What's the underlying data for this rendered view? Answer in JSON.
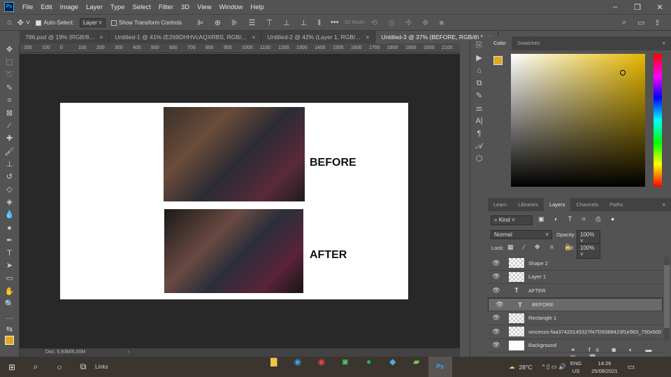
{
  "menu": [
    "File",
    "Edit",
    "Image",
    "Layer",
    "Type",
    "Select",
    "Filter",
    "3D",
    "View",
    "Window",
    "Help"
  ],
  "options": {
    "auto_select": "Auto-Select:",
    "layer_select": "Layer",
    "show_transform": "Show Transform Controls",
    "three_d_mode": "3D Mode:"
  },
  "tabs": [
    {
      "label": "786.psd @ 19% (RGB/8..."
    },
    {
      "label": "Untitled-1 @ 41% (E269DHHVcAQXRBS, RGB/..."
    },
    {
      "label": "Untitled-2 @ 42% (Layer 1, RGB/..."
    },
    {
      "label": "Untitled-3 @ 37% (BEFORE, RGB/8) *"
    }
  ],
  "ruler": [
    "200",
    "100",
    "0",
    "100",
    "200",
    "300",
    "400",
    "500",
    "600",
    "700",
    "800",
    "900",
    "1000",
    "1100",
    "1200",
    "1300",
    "1400",
    "1500",
    "1600",
    "1700",
    "1800",
    "1900",
    "2000",
    "2100"
  ],
  "document": {
    "before": "BEFORE",
    "after": "AFTER"
  },
  "status": {
    "doc": "Doc: 5,93M/6,00M"
  },
  "color_panel": {
    "tabs": [
      "Color",
      "Swatches"
    ],
    "foreground": "#e0a81c"
  },
  "layers_panel": {
    "tabs": [
      "Learn",
      "Libraries",
      "Layers",
      "Channels",
      "Paths"
    ],
    "kind": "Kind",
    "blend": "Normal",
    "opacity_label": "Opacity:",
    "opacity": "100%",
    "lock_label": "Lock:",
    "fill_label": "Fill:",
    "fill": "100%",
    "layers": [
      {
        "name": "Shape 2"
      },
      {
        "name": "Layer 1"
      },
      {
        "name": "AFTER"
      },
      {
        "name": "BEFORE"
      },
      {
        "name": "Rectangle 1"
      },
      {
        "name": "vincenzo-faa37420145327f47f26388423f1e963_750x500"
      },
      {
        "name": "Background"
      }
    ]
  },
  "taskbar": {
    "links": "Links",
    "weather": "28°C",
    "lang": "ENG",
    "region": "US",
    "time": "14:26",
    "date": "25/08/2021"
  }
}
